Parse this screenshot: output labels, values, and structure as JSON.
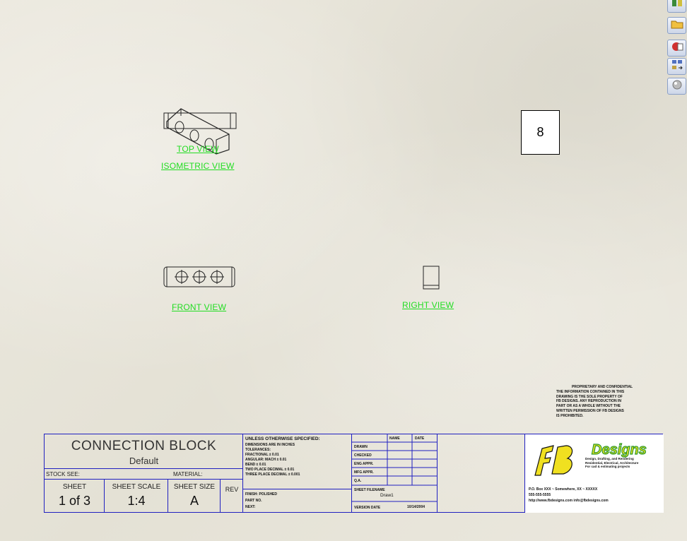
{
  "toolbar": {
    "icons": [
      "view-palette-icon",
      "open-folder-icon",
      "recent-documents-icon",
      "design-library-icon",
      "appearances-icon"
    ]
  },
  "views": {
    "top_label": "TOP VIEW",
    "isometric_label": "ISOMETRIC VIEW",
    "front_label": "FRONT VIEW",
    "right_label": "RIGHT VIEW"
  },
  "sheet_badge": "8",
  "proprietary": [
    "PROPRIETARY AND CONFIDENTIAL",
    "THE INFORMATION CONTAINED IN THIS",
    "DRAWING IS THE SOLE PROPERTY OF",
    "FB DESIGNS. ANY REPRODUCTION IN",
    "PART OR AS A WHOLE WITHOUT THE",
    "WRITTEN PERMISSION OF FB DESIGNS",
    "IS PROHIBITED."
  ],
  "title_block": {
    "title": "CONNECTION BLOCK",
    "config": "Default",
    "stock_label": "STOCK SEE:",
    "material_label": "MATERIAL:",
    "sheet_label": "SHEET",
    "sheet_value": "1 of 3",
    "scale_label": "SHEET SCALE",
    "scale_value": "1:4",
    "size_label": "SHEET SIZE",
    "size_value": "A",
    "rev_label": "REV",
    "tolerances": [
      "UNLESS OTHERWISE SPECIFIED:",
      "DIMENSIONS ARE IN INCHES",
      "TOLERANCES:",
      "FRACTIONAL ± 0.01",
      "ANGULAR: MACH ± 0.01",
      "BEND ± 0.01",
      "TWO PLACE DECIMAL    ± 0.01",
      "THREE PLACE DECIMAL  ± 0.001"
    ],
    "finish_lines": [
      "FINISH:  POLISHED",
      "PART NO.",
      "NEXT:"
    ],
    "approvals": {
      "header_name": "NAME",
      "header_date": "DATE",
      "rows": [
        "DRAWN",
        "CHECKED",
        "ENG APPR.",
        "MFG APPR.",
        "Q.A."
      ]
    },
    "drawing_name_label": "SHEET FILENAME",
    "drawing_name_value": "Draw1",
    "version_label": "VERSION DATE",
    "version_value": "10/14/2004"
  },
  "company": {
    "logo_text": "Designs",
    "logo_initials": "FB",
    "tagline_lines": [
      "Design, Drafting, and Rendering",
      "Residential, Electrical, Architecture",
      "For cad & estimating projects"
    ],
    "contact_lines": [
      "P.O. Box XXX  ~  Somewhere, XX ~ XXXXX",
      "555-555-5555",
      "http://www.fbdesigns.com        info@fbdesigns.com"
    ]
  },
  "colors": {
    "view_label": "#22dd22",
    "border": "#2020c0",
    "logo_yellow": "#f0e020",
    "logo_green": "#2a9a2a"
  }
}
